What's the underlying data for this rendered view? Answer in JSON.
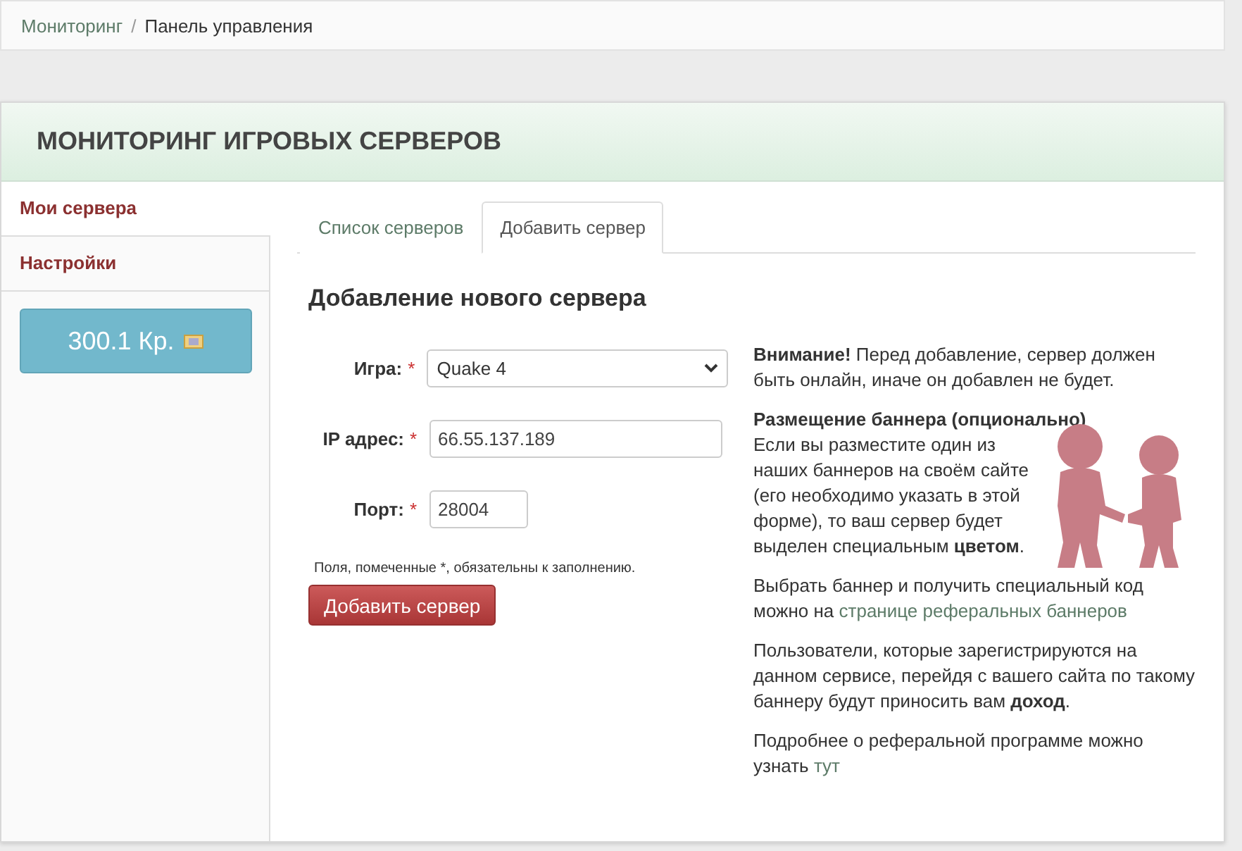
{
  "breadcrumb": {
    "items": [
      {
        "label": "Мониторинг",
        "kind": "link"
      },
      {
        "label": "Панель управления",
        "kind": "current"
      }
    ],
    "separator": "/"
  },
  "panel": {
    "title": "МОНИТОРИНГ ИГРОВЫХ СЕРВЕРОВ"
  },
  "sidebar": {
    "items": [
      {
        "label": "Мои сервера",
        "selected": true
      },
      {
        "label": "Настройки",
        "selected": false
      }
    ],
    "balance": "300.1 Кр."
  },
  "tabs": [
    {
      "label": "Список серверов",
      "selected": false
    },
    {
      "label": "Добавить сервер",
      "selected": true
    }
  ],
  "form": {
    "heading": "Добавление нового сервера",
    "fields": [
      {
        "kind": "select",
        "label": "Игра:",
        "required": "*",
        "value": "Quake 4"
      },
      {
        "kind": "input",
        "label": "IP адрес:",
        "required": "*",
        "value": "66.55.137.189"
      },
      {
        "kind": "short",
        "label": "Порт:",
        "required": "*",
        "value": "28004"
      }
    ],
    "note": "Поля, помеченные *, обязательны к заполнению.",
    "submit": "Добавить сервер"
  },
  "info": {
    "warning": "**Внимание!** Перед добавление, сервер должен быть онлайн, иначе он добавлен не будет.",
    "banner_heading": "Размещение баннера (опционально)",
    "banner_text": "Если вы разместите один из наших баннеров на своём сайте (его необходимо указать в этой форме), то ваш сервер будет выделен специальным **цветом**.",
    "paragraphs": [
      [
        {
          "kind": "text",
          "text": "Выбрать баннер и получить специальный код можно на "
        },
        {
          "kind": "link",
          "text": "странице реферальных баннеров"
        }
      ],
      [
        {
          "kind": "text",
          "text": "Пользователи, которые зарегистрируются на данном сервисе, перейдя с вашего сайта по такому баннеру будут приносить вам **доход**."
        }
      ],
      [
        {
          "kind": "text",
          "text": "Подробнее о реферальной программе можно узнать "
        },
        {
          "kind": "link",
          "text": "тут"
        }
      ]
    ]
  }
}
